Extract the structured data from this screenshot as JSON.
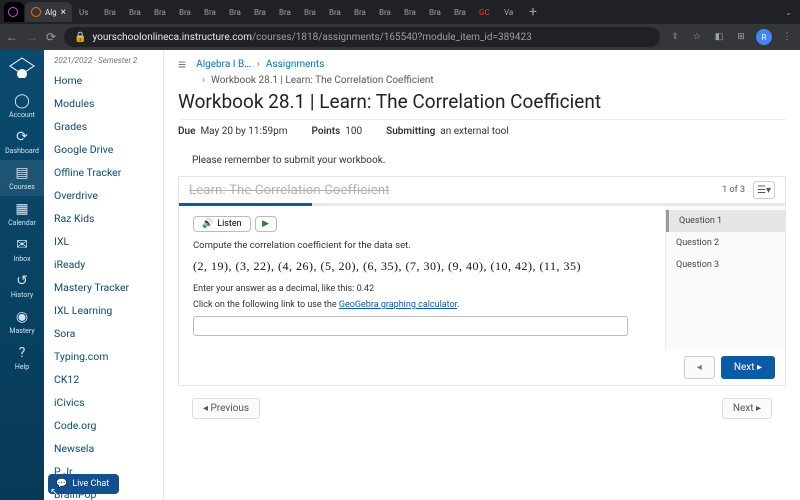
{
  "browser": {
    "tabs": {
      "active": "Alg",
      "others": [
        "Us",
        "Bra",
        "Bra",
        "Bra",
        "Bra",
        "Bra",
        "Bra",
        "Bra",
        "Bra",
        "Bra",
        "Bra",
        "Bra",
        "Bra",
        "Bra",
        "Bra",
        "Bra",
        "GC",
        "Va"
      ]
    },
    "url_host": "yourschoolonlineca.instructure.com",
    "url_path": "/courses/1818/assignments/165540?module_item_id=389423"
  },
  "rail": [
    {
      "icon": "◯",
      "label": "Account"
    },
    {
      "icon": "⟳",
      "label": "Dashboard"
    },
    {
      "icon": "▤",
      "label": "Courses"
    },
    {
      "icon": "▦",
      "label": "Calendar"
    },
    {
      "icon": "✉",
      "label": "Inbox"
    },
    {
      "icon": "↺",
      "label": "History"
    },
    {
      "icon": "◉",
      "label": "Mastery"
    },
    {
      "icon": "?",
      "label": "Help"
    }
  ],
  "sidebar": {
    "term": "2021/2022 - Semester 2",
    "links": [
      "Home",
      "Modules",
      "Grades",
      "Google Drive",
      "Offline Tracker",
      "Overdrive",
      "Raz Kids",
      "IXL",
      "iReady",
      "Mastery Tracker",
      "IXL Learning",
      "Sora",
      "Typing.com",
      "CK12",
      "iCivics",
      "Code.org",
      "Newsela",
      "P Jr.",
      "BrainPop"
    ]
  },
  "live_chat": "Live Chat",
  "breadcrumbs": {
    "a": "Algebra I B…",
    "b": "Assignments",
    "c": "Workbook 28.1 | Learn: The Correlation Coefficient"
  },
  "title": "Workbook 28.1 | Learn: The Correlation Coefficient",
  "meta": {
    "due_label": "Due",
    "due_val": "May 20 by 11:59pm",
    "pts_label": "Points",
    "pts_val": "100",
    "sub_label": "Submitting",
    "sub_val": "an external tool"
  },
  "notice": "Please remember to submit your workbook.",
  "tool": {
    "heading": "Learn: The Correlation Coefficient",
    "pager": "1 of 3",
    "listen": "Listen",
    "prompt": "Compute the correlation coefficient for the data set.",
    "dataset": "(2, 19), (3, 22), (4, 26), (5, 20), (6, 35), (7, 30), (9, 40), (10, 42), (11, 35)",
    "hint1": "Enter your answer as a decimal, like this: 0.42",
    "hint2a": "Click on the following link to use the ",
    "hint2b": "GeoGebra graphing calculator",
    "hint2c": ".",
    "questions": [
      "Question 1",
      "Question 2",
      "Question 3"
    ],
    "prev_btn": "◂",
    "next_btn": "Next  ▸"
  },
  "footer": {
    "prev": "◂ Previous",
    "next": "Next ▸"
  }
}
